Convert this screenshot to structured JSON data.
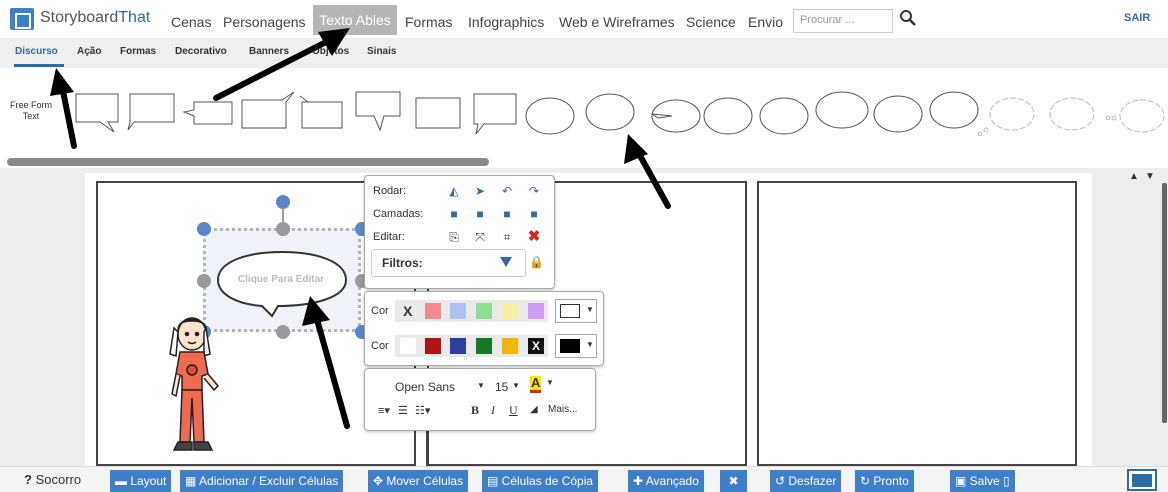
{
  "app": {
    "logo_prefix": "Storyboard",
    "logo_suffix": "That"
  },
  "nav": {
    "items": [
      "Cenas",
      "Personagens",
      "Texto Ables",
      "Formas",
      "Infographics",
      "Web e Wireframes",
      "Science",
      "Envio"
    ],
    "active": "Texto Ables",
    "search_placeholder": "Procurar ...",
    "logout": "SAIR"
  },
  "subnav": {
    "items": [
      "Discurso",
      "Ação",
      "Formas",
      "Decorativo",
      "Banners",
      "Objetos",
      "Sinais"
    ],
    "active": "Discurso"
  },
  "palette": {
    "free_form_label": "Free Form\nText"
  },
  "bubble": {
    "text": "Clique Para Editar"
  },
  "toolbox": {
    "rotate_label": "Rodar:",
    "layers_label": "Camadas:",
    "edit_label": "Editar:",
    "filters_label": "Filtros:",
    "color_label_1": "Cor",
    "color_label_2": "Cor",
    "colors_row1": [
      "#ffffff",
      "#f28b8b",
      "#a9c3f5",
      "#8ee08e",
      "#f6efa0",
      "#d39cf0"
    ],
    "colors_row2": [
      "#ffffff",
      "#b01515",
      "#2c3f9e",
      "#157a24",
      "#f5b400",
      "#111111"
    ],
    "font_name": "Open Sans",
    "font_size": "15",
    "more_label": "Mais..."
  },
  "bottom": {
    "help": "Socorro",
    "layout": "Layout",
    "add_remove": "Adicionar / Excluir Células",
    "move": "Mover Células",
    "copy": "Células de Cópia",
    "advanced": "Avançado",
    "undo": "Desfazer",
    "done": "Pronto",
    "save": "Salve"
  },
  "colors": {
    "accent": "#3d7fc8",
    "brand": "#2e6ba8"
  }
}
